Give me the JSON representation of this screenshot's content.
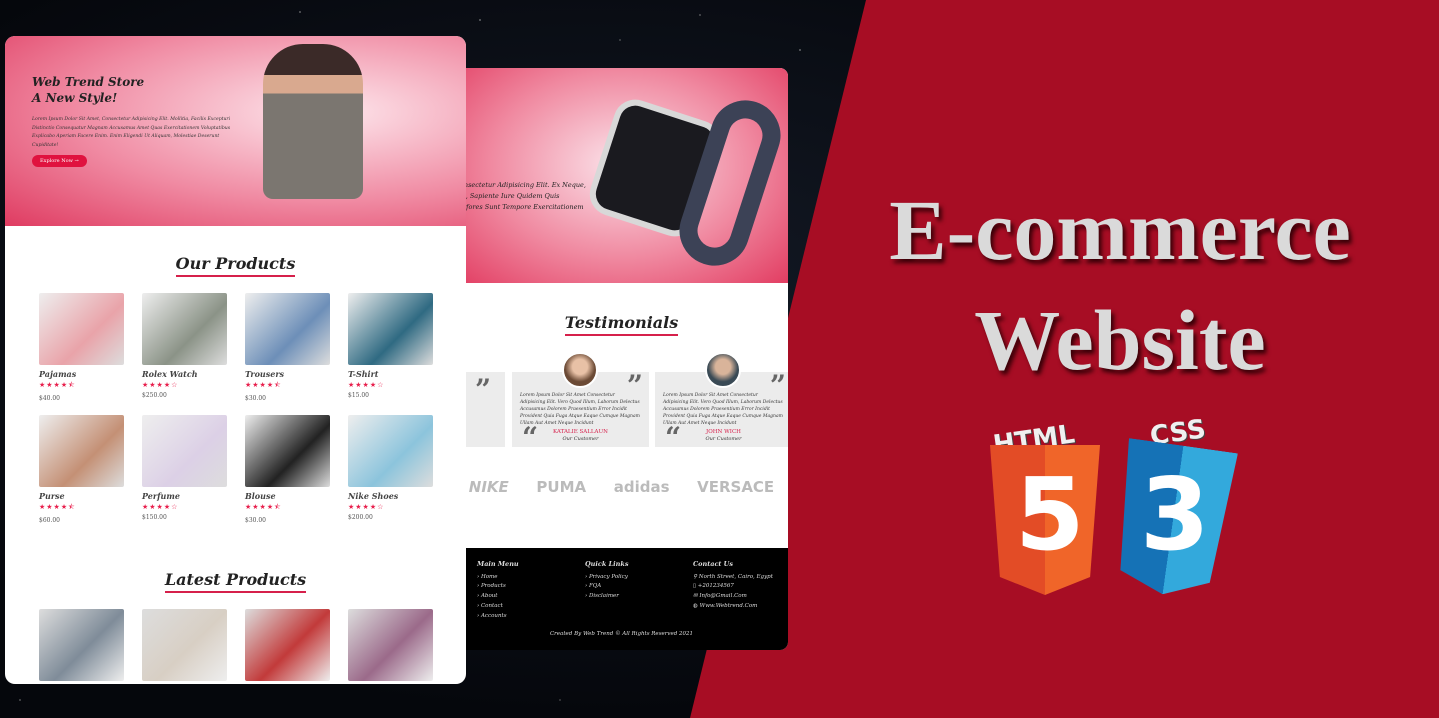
{
  "banner": {
    "title_line1": "E-commerce",
    "title_line2": "Website",
    "badges": [
      "HTML",
      "5",
      "CSS",
      "3"
    ]
  },
  "back_page": {
    "hero": {
      "text_lines": [
        "Consectetur Adipisicing Elit. Ex Neque,",
        "Est, Sapiente Iure Quidem Quis",
        "perfores Sunt Tempore Exercitationem"
      ]
    },
    "testimonials": {
      "title": "Testimonials",
      "items": [
        {
          "text": "Lorem Ipsum Dolor Sit Amet Consectetur Adipisicing Elit. Vero Quod Illum, Laborum Delectus Accusamus Dolorem Praesentium Error Incidit Provident Quia Fuga Atque Eaque Cumque Magnam Ullam Aut Amet Neque Incidunt",
          "name": "KATALIE SALLAUN",
          "role": "Our Customer"
        },
        {
          "text": "Lorem Ipsum Dolor Sit Amet Consectetur Adipisicing Elit. Vero Quod Illum, Laborum Delectus Accusamus Dolorem Praesentium Error Incidit Provident Quia Fuga Atque Eaque Cumque Magnam Ullam Aut Amet Neque Incidunt",
          "name": "JOHN WICH",
          "role": "Our Customer"
        }
      ]
    },
    "brands": [
      "NIKE",
      "PUMA",
      "adidas",
      "VERSACE"
    ],
    "footer": {
      "main_menu": {
        "title": "Main Menu",
        "items": [
          "Home",
          "Products",
          "About",
          "Contact",
          "Accounts"
        ]
      },
      "quick_links": {
        "title": "Quick Links",
        "items": [
          "Privacy Policy",
          "FQA",
          "Disclaimer"
        ]
      },
      "contact": {
        "title": "Contact Us",
        "items": [
          "North Street, Cairo, Egypt",
          "+201234567",
          "Info@Gmail.Com",
          "Www.Webtrend.Com"
        ]
      },
      "copyright": "Created By Web Trend © All Rights Reserved 2021"
    }
  },
  "front_page": {
    "hero": {
      "title_line1": "Web Trend Store",
      "title_line2": "A New Style!",
      "text": "Lorem Ipsum Dolor Sit Amet, Consectetur Adipisicing Elit. Mollitia, Facilis Excepturi Distinctio Consequatur Magnam Accusamus Amet Quas Exercitationem Voluptatibus Explicabo Aperiam Facere Enim. Enim Eligendi Ut Aliquam, Molestiae Deserunt Cupiditate!",
      "cta": "Explore Now →"
    },
    "our_products": {
      "title": "Our Products",
      "items": [
        {
          "name": "Pajamas",
          "rating": 4.5,
          "stars": "★★★★⯪",
          "price": "$40.00",
          "color": "#e9a3a9"
        },
        {
          "name": "Rolex Watch",
          "rating": 4,
          "stars": "★★★★☆",
          "price": "$250.00",
          "color": "#8b9387"
        },
        {
          "name": "Trousers",
          "rating": 4.5,
          "stars": "★★★★⯪",
          "price": "$30.00",
          "color": "#6d8fb8"
        },
        {
          "name": "T-Shirt",
          "rating": 4,
          "stars": "★★★★☆",
          "price": "$15.00",
          "color": "#2f6a82"
        },
        {
          "name": "Purse",
          "rating": 4.5,
          "stars": "★★★★⯪",
          "price": "$60.00",
          "color": "#c49075"
        },
        {
          "name": "Perfume",
          "rating": 4,
          "stars": "★★★★☆",
          "price": "$150.00",
          "color": "#dcd0e6"
        },
        {
          "name": "Blouse",
          "rating": 4.5,
          "stars": "★★★★⯪",
          "price": "$30.00",
          "color": "#222222"
        },
        {
          "name": "Nike Shoes",
          "rating": 4,
          "stars": "★★★★☆",
          "price": "$200.00",
          "color": "#8cc4dc"
        }
      ]
    },
    "latest_products": {
      "title": "Latest Products",
      "colors": [
        "#7f8c99",
        "#d8cfc4",
        "#c23a3a",
        "#9b6a8a"
      ]
    }
  }
}
